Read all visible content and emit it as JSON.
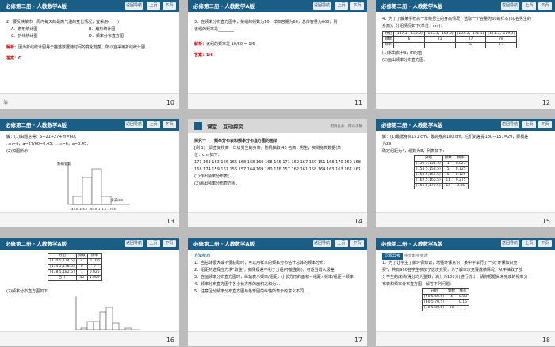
{
  "header": {
    "title": "必修第二册 · 人教数学A版",
    "nav": "返回导航",
    "prev": "上页",
    "next": "下页"
  },
  "s10": {
    "page": "10",
    "lines": [
      "2．要反映某市一周内每天的最高气温的变化情况，宜采用(　　)",
      "A．条形统计图",
      "B．扇形统计图",
      "C．折线统计图",
      "D．频率分布直方图"
    ],
    "sol_label": "解析：",
    "sol": "因为折线统计图易于描述数据随时间的变化趋势，所以宜采用折线统计图．",
    "ans_label": "答案：",
    "ans": "C",
    "footer": "治"
  },
  "s11": {
    "page": "11",
    "q1": "3．在频率分布直方图中，某组的频数为10，样本容量为60，总体容量为600，则",
    "q2": "该组的频率是________．",
    "sol_label": "解析：",
    "sol": "该组的频率是 10/60 = 1/6",
    "ans_label": "答案：",
    "ans": "1/6"
  },
  "s12": {
    "page": "12",
    "q1": "4．为了了解某学校高一年级男生的身高情况，选取一个容量为60的样本(60名男生的",
    "q2": "身高)，分组情况如下(单位：cm)：",
    "table": [
      [
        "分组",
        "[147.5，155.5)",
        "[155.5，163.5)",
        "[163.5，171.5)",
        "[171.5，179.5]"
      ],
      [
        "频数",
        "6",
        "21",
        "27",
        "m"
      ],
      [
        "频率",
        "",
        "",
        "a",
        "0.1"
      ]
    ],
    "q3": "(1)求出表中a，m的值；",
    "q4": "(2)画出频率分布直方图．"
  },
  "s13": {
    "page": "13",
    "l1": "解：(1)由题意得：6+21+27+m=60，",
    "l2": "∴m=6，a=27/60=0.45．∴m=6，a=0.45．",
    "l3": "(2)如图所示：",
    "chart": {
      "ylabel": "频率/组距",
      "xlabel": "身高/cm",
      "ticks": [
        "147.5",
        "155.5",
        "163.5",
        "171.5",
        "179.5"
      ]
    }
  },
  "s14": {
    "page": "14",
    "sect": "课堂 · 互动探究",
    "sect_r": "明辨是非　精心求解",
    "l1": "探究一　　频率分布表和频率分布直方图的画法",
    "l2": "[例 1]　调查某校高一年级男生的身高，随机抽取 40 名高一男生，实测身高数据(单",
    "l3": "位：cm)如下：",
    "d1": "171 163 163 166 166 168 168 160 168 165 171 169 167 169 151 168 170 160 168 174 165",
    "d2": "168 174 159 167 156 157 164 169 180 176 157 162 161 158 164 163 163 167 161",
    "l4": "(1)作出频率分布表；",
    "l5": "(2)画出频率分布直方图．"
  },
  "s15": {
    "page": "15",
    "l1": "解：(1)最低身高151 cm，最高身高180 cm，它们的差是180－151=29，即极差",
    "l2": "为29；",
    "l3": "确定组距为4，组数为8，列表如下：",
    "table": [
      [
        "分组",
        "频数",
        "频率"
      ],
      [
        "[150.5,154.5)",
        "1",
        "0.025"
      ],
      [
        "[154.5,158.5)",
        "5",
        "0.125"
      ],
      [
        "[158.5,162.5)",
        "5",
        "0.125"
      ],
      [
        "[162.5,166.5)",
        "11",
        "0.275"
      ],
      [
        "[166.5,170.5)",
        "14",
        "0.35"
      ]
    ]
  },
  "s16": {
    "page": "16",
    "table": [
      [
        "分组",
        "频数",
        "频率"
      ],
      [
        "[170.5,174.5)",
        "4",
        "0.100"
      ],
      [
        "[174.5,178.5)",
        "0",
        "0"
      ],
      [
        "[178.5,182.5]",
        "1",
        "0.025"
      ],
      [
        "合计",
        "40",
        "1.000"
      ]
    ],
    "l1": "(2)频率分布直方图如下．"
  },
  "s17": {
    "page": "17",
    "sect": "方法技巧",
    "l1": "1．当总体很大或不便获取时，可以用样本的频率分布估计总体的频率分布．",
    "l2": "2．组距的选择应力求\"取整\"，如果极差不利于分组(不能整除)，可适当增大极差．",
    "l3": "3．在画频率分布直方图时，纵轴表示频率/组距，小长方形的面积＝组距×频率/组距＝频率．",
    "l4": "4．频率分布直方图中各小长方形的面积之和为1．",
    "l5": "5．注意区分频率分布直方图与条形图的纵轴所表示的意义不同．"
  },
  "s18": {
    "page": "18",
    "tag": "同源异考",
    "tag2": "金长触类旁通",
    "l1": "1．为了让学生了解环保知识，增强环保意识，某中学举行了一次\"环保知识竞",
    "l2": "赛\"，共有900名学生参加了这次竞赛，为了解本次竞赛成绩情况，从中抽取了部",
    "l3": "分学生的成绩(得分均为整数，满分为100分)进行统计，请你根据尚未完成的频率分",
    "l4": "布表和频率分布直方图，解答下列问题：",
    "table": [
      [
        "分组",
        "频数",
        "频率"
      ],
      [
        "[50.5,60.5)",
        "4",
        "0.08"
      ],
      [
        "[60.5,70.5)",
        "",
        "0.16"
      ],
      [
        "[70.5,80.5)",
        "10",
        ""
      ]
    ]
  }
}
